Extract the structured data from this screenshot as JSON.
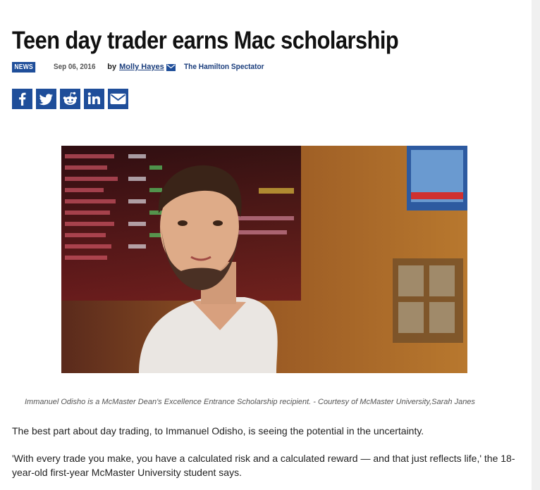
{
  "article": {
    "headline": "Teen day trader earns Mac scholarship",
    "category_badge": "NEWS",
    "date": "Sep 06, 2016",
    "by_label": "by",
    "author": "Molly Hayes",
    "outlet": "The Hamilton Spectator",
    "caption": "Immanuel Odisho is a McMaster Dean's Excellence Entrance Scholarship recipient. - Courtesy of McMaster University,Sarah Janes",
    "paragraphs": [
      "The best part about day trading, to Immanuel Odisho, is seeing the potential in the uncertainty.",
      "'With every trade you make, you have a calculated risk and a calculated reward — and that just reflects life,' the 18-year-old first-year McMaster University student says."
    ]
  },
  "share": {
    "icons": [
      "facebook-icon",
      "twitter-icon",
      "reddit-icon",
      "linkedin-icon",
      "email-icon"
    ]
  },
  "colors": {
    "brand_blue": "#1f4e9a",
    "link_blue": "#1a3d7c",
    "text": "#222222",
    "caption": "#555555"
  }
}
